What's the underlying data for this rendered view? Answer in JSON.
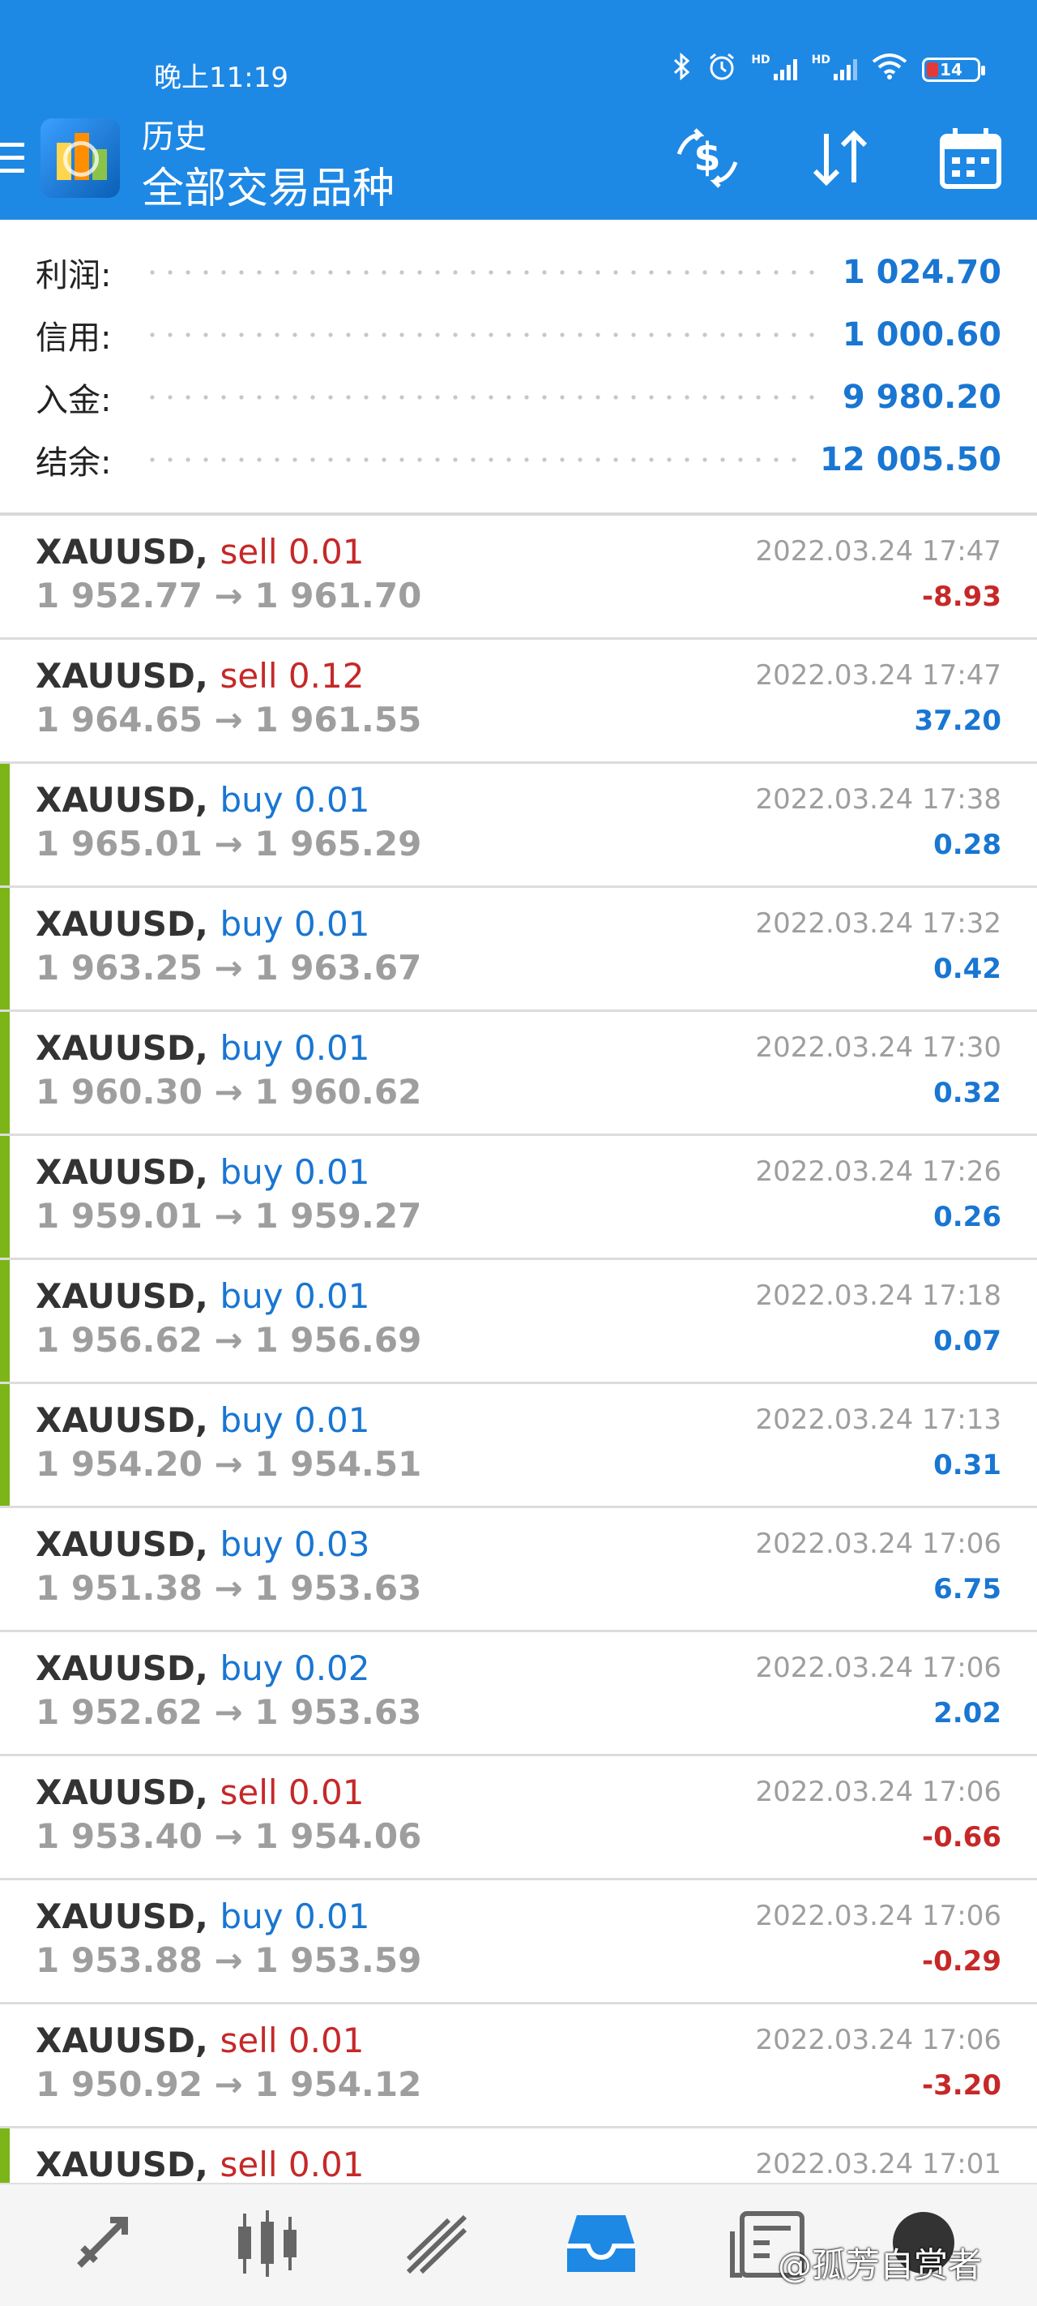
{
  "status_bar": {
    "time": "晚上11:19",
    "hd1": "HD",
    "hd2": "HD",
    "battery": "14",
    "icons": [
      "bluetooth-icon",
      "alarm-icon",
      "signal-icon",
      "signal-icon",
      "wifi-icon",
      "battery-icon"
    ]
  },
  "header": {
    "title_small": "历史",
    "title_large": "全部交易品种",
    "buttons": [
      "currency-exchange-icon",
      "sort-icon",
      "calendar-icon"
    ],
    "color": "#1e88e5"
  },
  "summary": [
    {
      "label": "利润:",
      "value": "1 024.70"
    },
    {
      "label": "信用:",
      "value": "1 000.60"
    },
    {
      "label": "入金:",
      "value": "9 980.20"
    },
    {
      "label": "结余:",
      "value": "12 005.50"
    }
  ],
  "deals": [
    {
      "symbol": "XAUUSD,",
      "type": "sell 0.01",
      "side": "sell",
      "open": "1 952.77",
      "close": "1 961.70",
      "time": "2022.03.24 17:47",
      "profit": "-8.93",
      "marker": false
    },
    {
      "symbol": "XAUUSD,",
      "type": "sell 0.12",
      "side": "sell",
      "open": "1 964.65",
      "close": "1 961.55",
      "time": "2022.03.24 17:47",
      "profit": "37.20",
      "marker": false
    },
    {
      "symbol": "XAUUSD,",
      "type": "buy 0.01",
      "side": "buy",
      "open": "1 965.01",
      "close": "1 965.29",
      "time": "2022.03.24 17:38",
      "profit": "0.28",
      "marker": true
    },
    {
      "symbol": "XAUUSD,",
      "type": "buy 0.01",
      "side": "buy",
      "open": "1 963.25",
      "close": "1 963.67",
      "time": "2022.03.24 17:32",
      "profit": "0.42",
      "marker": true
    },
    {
      "symbol": "XAUUSD,",
      "type": "buy 0.01",
      "side": "buy",
      "open": "1 960.30",
      "close": "1 960.62",
      "time": "2022.03.24 17:30",
      "profit": "0.32",
      "marker": true
    },
    {
      "symbol": "XAUUSD,",
      "type": "buy 0.01",
      "side": "buy",
      "open": "1 959.01",
      "close": "1 959.27",
      "time": "2022.03.24 17:26",
      "profit": "0.26",
      "marker": true
    },
    {
      "symbol": "XAUUSD,",
      "type": "buy 0.01",
      "side": "buy",
      "open": "1 956.62",
      "close": "1 956.69",
      "time": "2022.03.24 17:18",
      "profit": "0.07",
      "marker": true
    },
    {
      "symbol": "XAUUSD,",
      "type": "buy 0.01",
      "side": "buy",
      "open": "1 954.20",
      "close": "1 954.51",
      "time": "2022.03.24 17:13",
      "profit": "0.31",
      "marker": true
    },
    {
      "symbol": "XAUUSD,",
      "type": "buy 0.03",
      "side": "buy",
      "open": "1 951.38",
      "close": "1 953.63",
      "time": "2022.03.24 17:06",
      "profit": "6.75",
      "marker": false
    },
    {
      "symbol": "XAUUSD,",
      "type": "buy 0.02",
      "side": "buy",
      "open": "1 952.62",
      "close": "1 953.63",
      "time": "2022.03.24 17:06",
      "profit": "2.02",
      "marker": false
    },
    {
      "symbol": "XAUUSD,",
      "type": "sell 0.01",
      "side": "sell",
      "open": "1 953.40",
      "close": "1 954.06",
      "time": "2022.03.24 17:06",
      "profit": "-0.66",
      "marker": false
    },
    {
      "symbol": "XAUUSD,",
      "type": "buy 0.01",
      "side": "buy",
      "open": "1 953.88",
      "close": "1 953.59",
      "time": "2022.03.24 17:06",
      "profit": "-0.29",
      "marker": false
    },
    {
      "symbol": "XAUUSD,",
      "type": "sell 0.01",
      "side": "sell",
      "open": "1 950.92",
      "close": "1 954.12",
      "time": "2022.03.24 17:06",
      "profit": "-3.20",
      "marker": false
    },
    {
      "symbol": "XAUUSD,",
      "type": "sell 0.01",
      "side": "sell",
      "open": "",
      "close": "",
      "time": "2022.03.24 17:01",
      "profit": "",
      "marker": true
    }
  ],
  "arrow": "→",
  "bottom_nav": {
    "items": [
      "quotes-icon",
      "chart-icon",
      "trade-icon",
      "history-icon",
      "news-icon",
      "messages-icon"
    ],
    "active": "history-icon",
    "watermark": "@孤芳自赏者"
  }
}
